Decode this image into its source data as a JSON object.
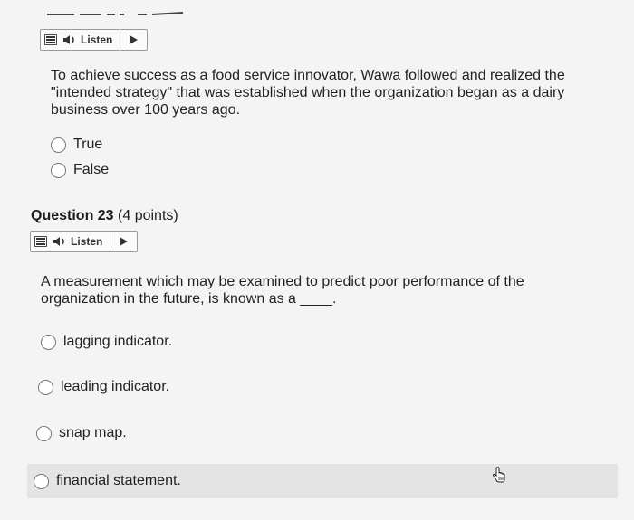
{
  "q22": {
    "listen_label": "Listen",
    "question": "To achieve success as a food service innovator, Wawa followed and realized the \"intended strategy\" that was established when the organization began as a dairy business over 100 years ago.",
    "options": [
      "True",
      "False"
    ]
  },
  "q23": {
    "heading_bold": "Question 23",
    "heading_points": "(4 points)",
    "listen_label": "Listen",
    "question": "A measurement which may be examined to predict poor performance of the organization in the future, is known as a ____.",
    "options": [
      "lagging indicator.",
      "leading indicator.",
      "snap map.",
      "financial statement."
    ]
  }
}
